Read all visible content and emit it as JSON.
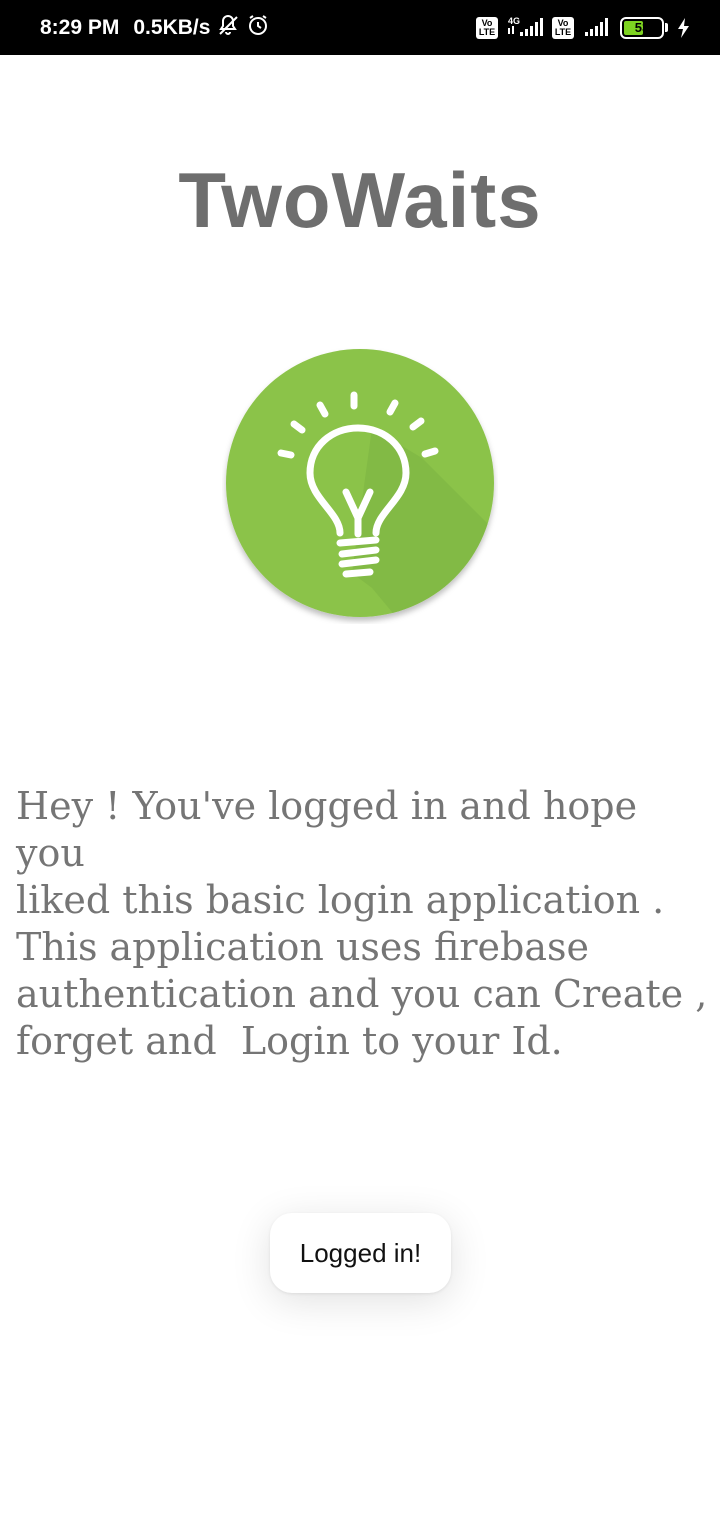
{
  "status_bar": {
    "time": "8:29 PM",
    "net_speed": "0.5KB/s",
    "battery_level": "53",
    "battery_color": "#7ed321",
    "network_type": "4G",
    "volte_label": "Vo\nLTE",
    "icons": [
      "mute-icon",
      "alarm-icon",
      "volte-icon",
      "signal-icon",
      "volte-icon",
      "signal-icon",
      "battery-icon",
      "charging-icon"
    ]
  },
  "app": {
    "title": "TwoWaits",
    "logo_icon": "lightbulb-icon",
    "logo_color": "#8bc34a"
  },
  "main": {
    "message": "Hey ! You've logged in and hope you\nliked this basic login application .\nThis application uses firebase\nauthentication and you can Create ,\nforget and  Login to your Id."
  },
  "toast": {
    "text": "Logged in!"
  }
}
